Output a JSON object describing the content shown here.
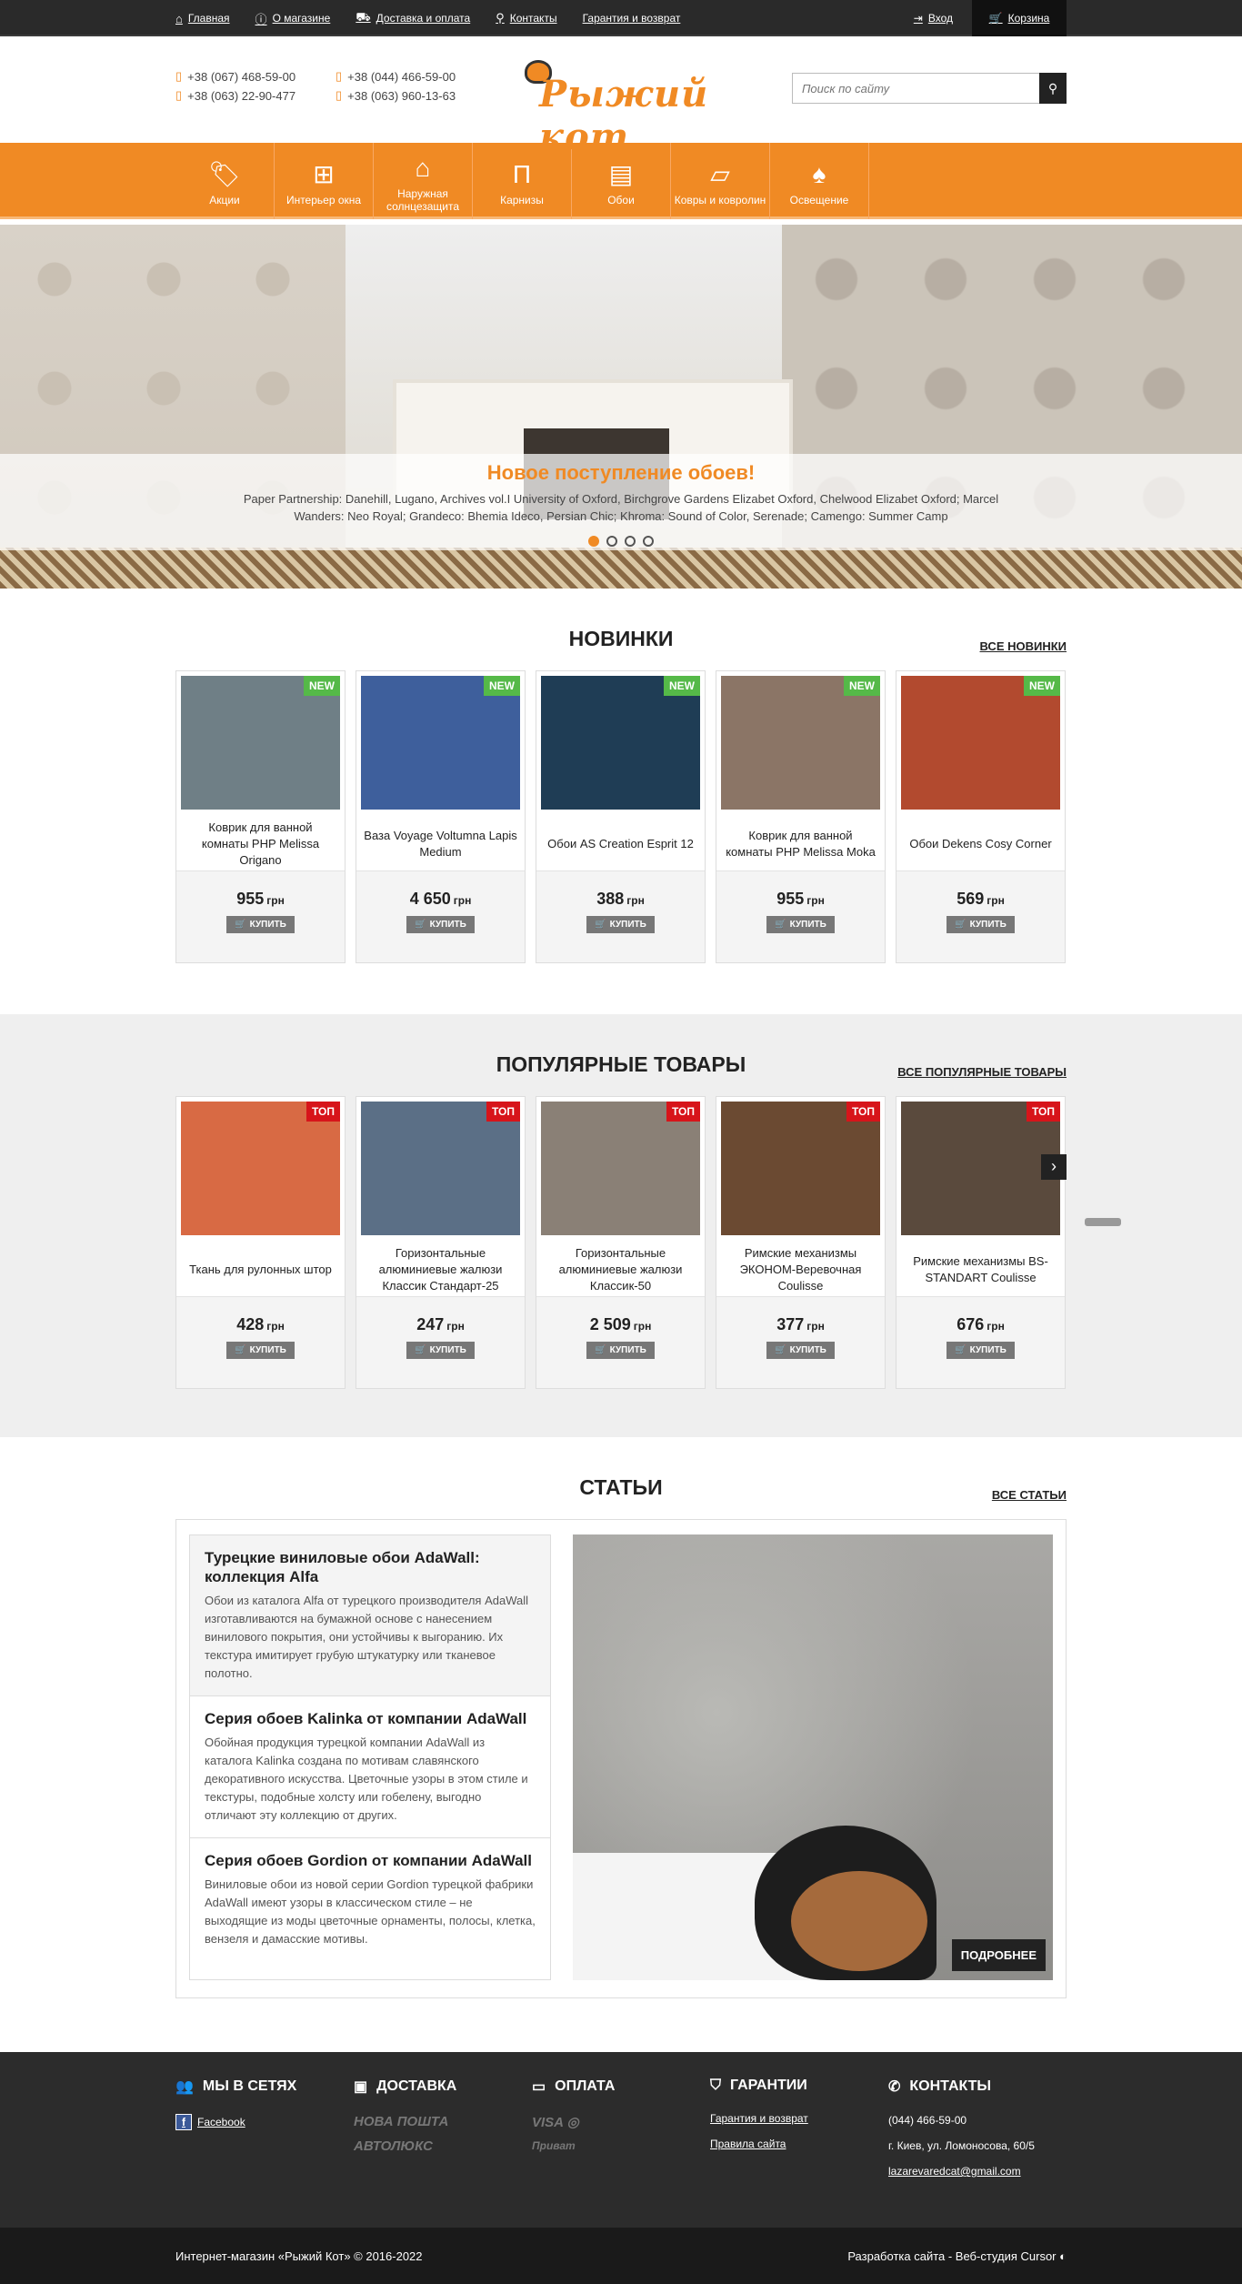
{
  "topnav": {
    "items": [
      {
        "label": "Главная",
        "icon": "home-icon"
      },
      {
        "label": "О магазине",
        "icon": "info-icon"
      },
      {
        "label": "Доставка и оплата",
        "icon": "truck-icon"
      },
      {
        "label": "Контакты",
        "icon": "location-icon"
      },
      {
        "label": "Гарантия и возврат",
        "icon": ""
      }
    ],
    "login": "Вход",
    "cart": "Корзина"
  },
  "header": {
    "phones": [
      "+38 (067) 468-59-00",
      "+38 (044) 466-59-00",
      "+38 (063) 22-90-477",
      "+38 (063) 960-13-63"
    ],
    "logo": "Рыжий кот",
    "search_placeholder": "Поиск по сайту"
  },
  "catnav": {
    "items": [
      {
        "label": "Акции",
        "icon": "sale-tag-icon"
      },
      {
        "label": "Интерьер окна",
        "icon": "window-icon"
      },
      {
        "label": "Наружная солнцезащита",
        "icon": "awning-icon"
      },
      {
        "label": "Карнизы",
        "icon": "curtain-rod-icon"
      },
      {
        "label": "Обои",
        "icon": "wallpaper-roll-icon"
      },
      {
        "label": "Ковры и ковролин",
        "icon": "carpet-icon"
      },
      {
        "label": "Освещение",
        "icon": "lamp-icon"
      }
    ]
  },
  "hero": {
    "title": "Новое поступление обоев!",
    "text": "Paper Partnership: Danehill, Lugano, Archives vol.I University of Oxford, Birchgrove Gardens Elizabet Oxford, Chelwood Elizabet Oxford; Marcel Wanders: Neo Royal; Grandeco: Bhemia Ideco, Persian Chic; Khroma: Sound of Color, Serenade; Camengo: Summer Camp",
    "slides": 4,
    "active_slide": 1
  },
  "new_section": {
    "title": "НОВИНКИ",
    "link": "ВСЕ НОВИНКИ",
    "badge": "NEW",
    "currency": "грн",
    "buy": "КУПИТЬ",
    "products": [
      {
        "name": "Коврик для ванной комнаты PHP Melissa Origano",
        "price": "955",
        "color": "#6f7f86"
      },
      {
        "name": "Ваза Voyage Voltumna Lapis Medium",
        "price": "4 650",
        "color": "#3e5f9c"
      },
      {
        "name": "Обои AS Creation Esprit 12",
        "price": "388",
        "color": "#1f3d55"
      },
      {
        "name": "Коврик для ванной комнаты PHP Melissa Moka",
        "price": "955",
        "color": "#8b7566"
      },
      {
        "name": "Обои Dekens Cosy Corner",
        "price": "569",
        "color": "#b24a2f"
      }
    ]
  },
  "popular_section": {
    "title": "ПОПУЛЯРНЫЕ ТОВАРЫ",
    "link": "ВСЕ ПОПУЛЯРНЫЕ ТОВАРЫ",
    "badge": "ТОП",
    "currency": "грн",
    "buy": "КУПИТЬ",
    "products": [
      {
        "name": "Ткань для рулонных штор",
        "price": "428",
        "color": "#d86a44"
      },
      {
        "name": "Горизонтальные алюминиевые жалюзи Классик Стандарт-25",
        "price": "247",
        "color": "#5b6f86"
      },
      {
        "name": "Горизонтальные алюминиевые жалюзи Классик-50",
        "price": "2 509",
        "color": "#8a8076"
      },
      {
        "name": "Римские механизмы ЭКОНОМ-Веревочная Coulisse",
        "price": "377",
        "color": "#6b4a32"
      },
      {
        "name": "Римские механизмы BS-STANDART Coulisse",
        "price": "676",
        "color": "#5a4a3d"
      }
    ]
  },
  "articles_section": {
    "title": "СТАТЬИ",
    "link": "ВСЕ СТАТЬИ",
    "more": "ПОДРОБНЕЕ",
    "items": [
      {
        "title": "Турецкие виниловые обои AdaWall: коллекция Alfa",
        "text": "Обои из каталога Alfa от турецкого производителя AdaWall изготавливаются на бумажной основе с нанесением винилового покрытия, они устойчивы к выгоранию. Их текстура имитирует грубую штукатурку или тканевое полотно."
      },
      {
        "title": "Серия обоев Kalinka от компании AdaWall",
        "text": "Обойная продукция турецкой компании AdaWall из каталога Kalinka создана по мотивам славянского декоративного искусства. Цветочные узоры в этом стиле и текстуры, подобные холсту или гобелену, выгодно отличают эту коллекцию от других."
      },
      {
        "title": "Серия обоев Gordion от компании AdaWall",
        "text": "Виниловые обои из новой серии Gordion турецкой фабрики AdaWall имеют узоры в классическом стиле – не выходящие из моды цветочные орнаменты, полосы, клетка, вензеля и дамасские мотивы."
      }
    ]
  },
  "footer": {
    "social": {
      "title": "МЫ В СЕТЯХ",
      "facebook": "Facebook"
    },
    "delivery": {
      "title": "ДОСТАВКА",
      "logos": [
        "НОВА ПОШТА",
        "АВТОЛЮКС"
      ]
    },
    "payment": {
      "title": "ОПЛАТА",
      "logos": [
        "VISA",
        "Приват"
      ]
    },
    "guarantee": {
      "title": "ГАРАНТИИ",
      "links": [
        "Гарантия и возврат",
        "Правила сайта"
      ]
    },
    "contacts": {
      "title": "КОНТАКТЫ",
      "phone": "(044) 466-59-00",
      "address": "г. Киев, ул. Ломоносова, 60/5",
      "email": "lazarevaredcat@gmail.com"
    },
    "copyright": "Интернет-магазин «Рыжий Кот» © 2016-2022",
    "developer": "Разработка сайта - Веб-студия Cursor"
  },
  "colors": {
    "accent": "#f08a24",
    "new_badge": "#55b948",
    "top_badge": "#d7141a",
    "dark": "#2c2c2c"
  }
}
